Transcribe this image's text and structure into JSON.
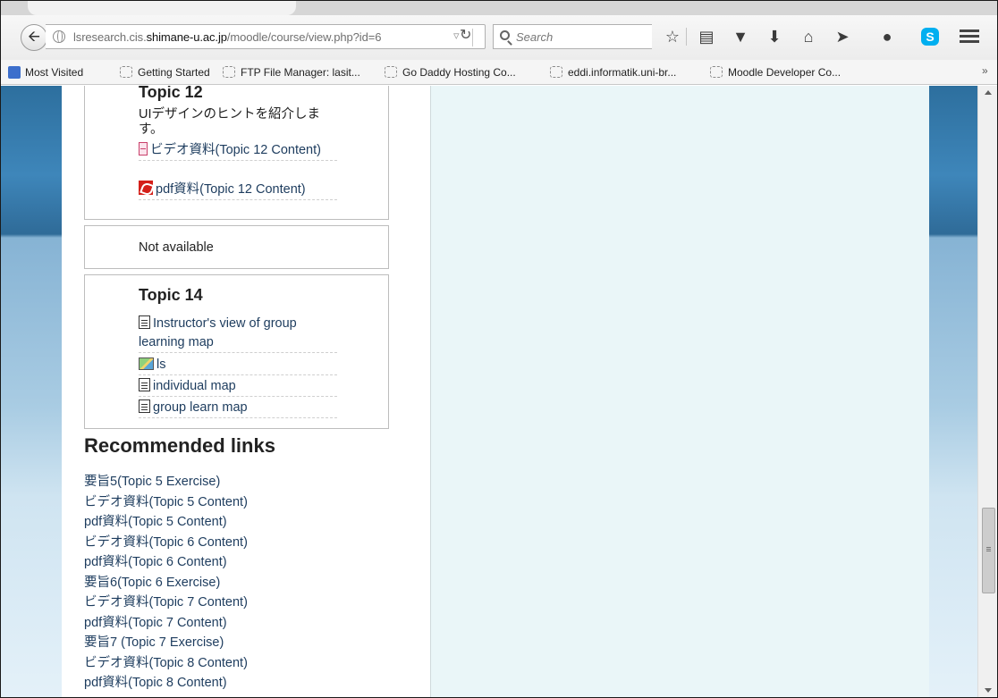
{
  "browser": {
    "url_host_prefix": "lsresearch.cis.",
    "url_domain": "shimane-u.ac.jp",
    "url_path": "/moodle/course/view.php?id=6",
    "search_placeholder": "Search",
    "toolbar_icons": [
      "bookmark-star-icon",
      "reading-list-icon",
      "pocket-icon",
      "downloads-icon",
      "home-icon",
      "send-icon",
      "chat-icon",
      "skype-icon",
      "menu-icon"
    ],
    "skype_letter": "S",
    "bookmarks": [
      "Most Visited",
      "Getting Started",
      "FTP File Manager: lasit...",
      "Go Daddy Hosting Co...",
      "eddi.informatik.uni-br...",
      "Moodle Developer Co..."
    ],
    "bookmarks_more": "»"
  },
  "topic12": {
    "title": "Topic 12",
    "description": "UIデザインのヒントを紹介します。",
    "activities": [
      {
        "label": "ビデオ資料(Topic 12 Content)",
        "icon": "video-file-icon"
      },
      {
        "label": "pdf資料(Topic 12 Content)",
        "icon": "pdf-icon"
      }
    ]
  },
  "topic13": {
    "status": "Not available"
  },
  "topic14": {
    "title": "Topic 14",
    "activities": [
      {
        "label": "Instructor's view of group learning map",
        "icon": "page-icon"
      },
      {
        "label": "ls",
        "icon": "map-icon"
      },
      {
        "label": "individual map",
        "icon": "page-icon"
      },
      {
        "label": "group learn map",
        "icon": "page-icon"
      }
    ]
  },
  "recommended": {
    "title": "Recommended links",
    "links": [
      "要旨5(Topic 5 Exercise)",
      "ビデオ資料(Topic 5 Content)",
      "pdf資料(Topic 5 Content)",
      "ビデオ資料(Topic 6 Content)",
      "pdf資料(Topic 6 Content)",
      "要旨6(Topic 6 Exercise)",
      "ビデオ資料(Topic 7 Content)",
      "pdf資料(Topic 7 Content)",
      "要旨7 (Topic 7 Exercise)",
      "ビデオ資料(Topic 8 Content)",
      "pdf資料(Topic 8 Content)"
    ]
  },
  "colors": {
    "link": "#1d3c5e",
    "theme_blue": "#2d6f9e",
    "page_bg": "#eaf6f8"
  }
}
